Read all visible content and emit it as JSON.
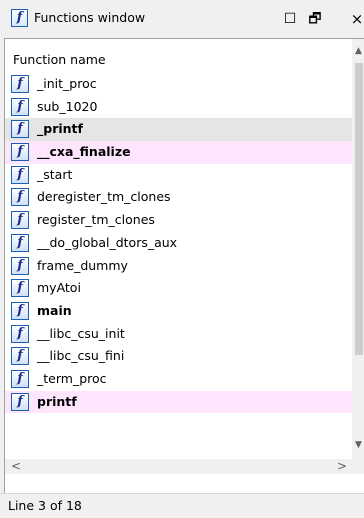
{
  "window": {
    "title": "Functions window",
    "icon": "function-icon",
    "controls": {
      "maximize": "☐",
      "restore": "🗗",
      "close": "×"
    }
  },
  "table": {
    "column_header": "Function name",
    "rows": [
      {
        "name": "_init_proc",
        "bold": false,
        "style": "normal"
      },
      {
        "name": "sub_1020",
        "bold": false,
        "style": "normal"
      },
      {
        "name": "_printf",
        "bold": true,
        "style": "selected"
      },
      {
        "name": "__cxa_finalize",
        "bold": true,
        "style": "highlighted"
      },
      {
        "name": "_start",
        "bold": false,
        "style": "normal"
      },
      {
        "name": "deregister_tm_clones",
        "bold": false,
        "style": "normal"
      },
      {
        "name": "register_tm_clones",
        "bold": false,
        "style": "normal"
      },
      {
        "name": "__do_global_dtors_aux",
        "bold": false,
        "style": "normal"
      },
      {
        "name": "frame_dummy",
        "bold": false,
        "style": "normal"
      },
      {
        "name": "myAtoi",
        "bold": false,
        "style": "normal"
      },
      {
        "name": "main",
        "bold": true,
        "style": "normal"
      },
      {
        "name": "__libc_csu_init",
        "bold": false,
        "style": "normal"
      },
      {
        "name": "__libc_csu_fini",
        "bold": false,
        "style": "normal"
      },
      {
        "name": "_term_proc",
        "bold": false,
        "style": "normal"
      },
      {
        "name": "printf",
        "bold": true,
        "style": "highlighted"
      }
    ],
    "icon_glyph": "f"
  },
  "scrollbars": {
    "up_arrow": "▲",
    "down_arrow": "▼",
    "left_arrow": "<",
    "right_arrow": ">"
  },
  "status": {
    "text": "Line 3 of 18"
  },
  "colors": {
    "highlight_row": "#fde6fd",
    "selected_row": "#e5e5e5",
    "icon_border": "#1a5fb4"
  }
}
